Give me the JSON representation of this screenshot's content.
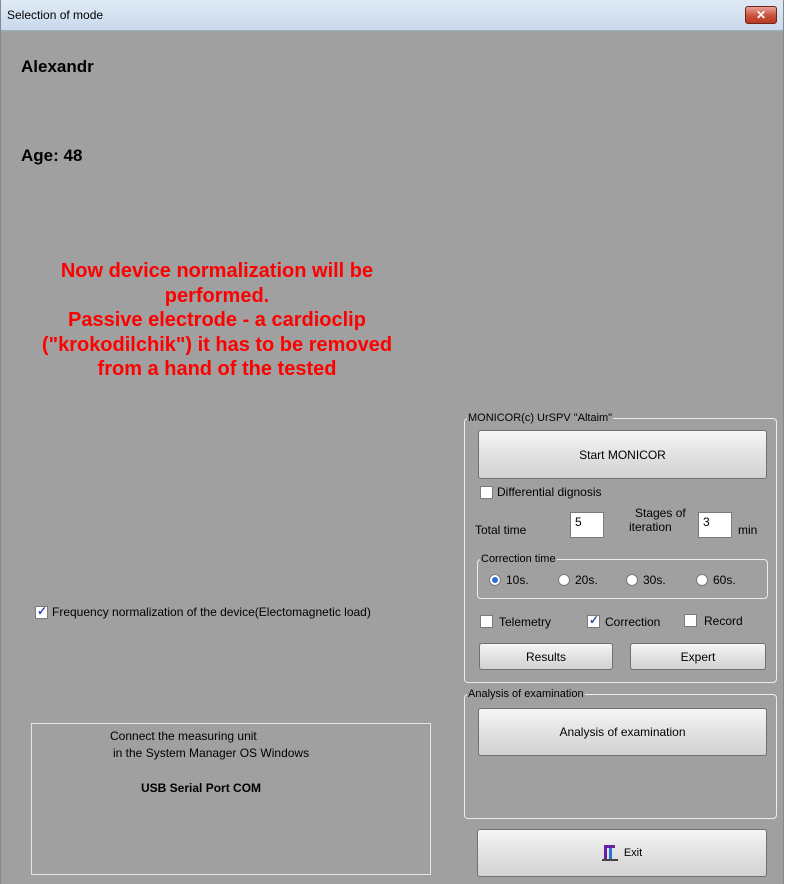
{
  "window": {
    "title": "Selection of mode",
    "close_label": "✕"
  },
  "patient": {
    "name": "Alexandr",
    "age": "Age: 48"
  },
  "notice": {
    "text": "Now device normalization will be performed.\nPassive electrode - a cardioclip (\"krokodilchik\") it has to be removed from a hand of the tested",
    "color": "#ff0000"
  },
  "frequency_normalization": {
    "label": "Frequency normalization of the device(Electomagnetic load)",
    "checked": true
  },
  "info": {
    "line1": "Connect the measuring unit",
    "line2": "in the System Manager OS Windows",
    "port": "USB Serial Port COM"
  },
  "monicor": {
    "legend": "MONICOR(c) UrSPV \"Altaim\"",
    "start_button": "Start MONICOR",
    "differential": {
      "label": "Differential dignosis",
      "checked": false
    },
    "total_time_label": "Total time",
    "total_time_value": "5",
    "stages_label_line1": "Stages of",
    "stages_label_line2": "iteration",
    "stages_value": "3",
    "min_label": "min",
    "correction_time": {
      "legend": "Correction time",
      "options": [
        "10s.",
        "20s.",
        "30s.",
        "60s."
      ],
      "selected": "10s."
    },
    "telemetry": {
      "label": "Telemetry",
      "checked": false
    },
    "correction": {
      "label": "Correction",
      "checked": true
    },
    "record": {
      "label": "Record",
      "checked": false
    },
    "results_button": "Results",
    "expert_button": "Expert"
  },
  "analysis": {
    "legend": "Analysis of examination",
    "button": "Analysis of examination"
  },
  "exit": {
    "label": "Exit",
    "icon": "exit-door-icon"
  },
  "colors": {
    "background": "#a0a0a0",
    "accent": "#2b6dd4",
    "notice": "#ff0000"
  }
}
